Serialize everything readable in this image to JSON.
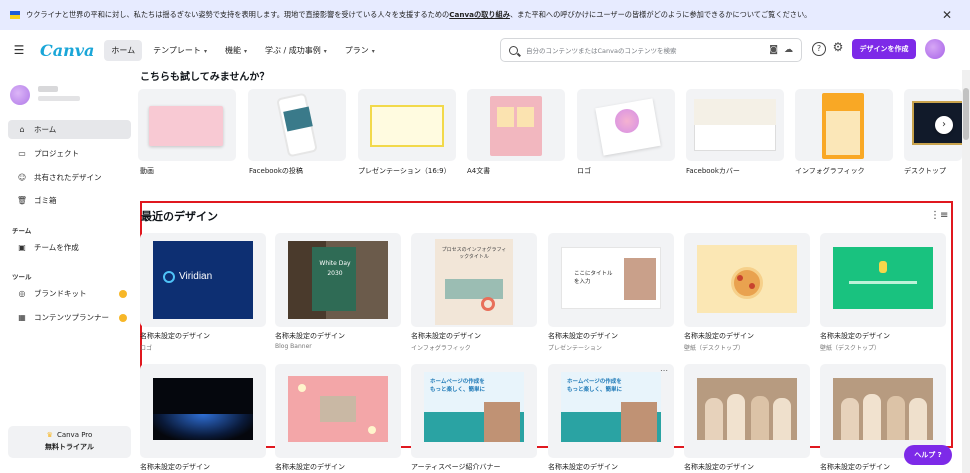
{
  "banner": {
    "text_before": "ウクライナと世界の平和に対し、私たちは揺るぎない姿勢で支持を表明します。現地で直接影響を受けている人々を支援するための",
    "link": "Canvaの取り組み",
    "text_after": "、また平和への呼びかけにユーザーの皆様がどのように参加できるかについてご覧ください。",
    "close": "✕"
  },
  "header": {
    "logo": "Canva",
    "nav": [
      {
        "label": "ホーム",
        "active": true
      },
      {
        "label": "テンプレート",
        "caret": "▾"
      },
      {
        "label": "機能",
        "caret": "▾"
      },
      {
        "label": "学ぶ / 成功事例",
        "caret": "▾"
      },
      {
        "label": "プラン",
        "caret": "▾"
      }
    ],
    "search_placeholder": "自分のコンテンツまたはCanvaのコンテンツを検索",
    "help_icon": "?",
    "settings_icon": "⚙",
    "create_button": "デザインを作成"
  },
  "sidebar": {
    "items": [
      {
        "label": "ホーム",
        "icon": "⌂",
        "active": true
      },
      {
        "label": "プロジェクト",
        "icon": "▭"
      },
      {
        "label": "共有されたデザイン",
        "icon": "☺"
      },
      {
        "label": "ゴミ箱",
        "icon": "🗑"
      }
    ],
    "team_heading": "チーム",
    "team_items": [
      {
        "label": "チームを作成",
        "icon": "▣"
      }
    ],
    "tools_heading": "ツール",
    "tool_items": [
      {
        "label": "ブランドキット",
        "icon": "◎"
      },
      {
        "label": "コンテンツプランナー",
        "icon": "▦"
      }
    ],
    "trial": {
      "line1": "Canva Pro",
      "line2": "無料トライアル",
      "crown": "♛"
    }
  },
  "suggest": {
    "title": "こちらも試してみませんか？",
    "items": [
      {
        "label": "動画"
      },
      {
        "label": "Facebookの投稿"
      },
      {
        "label": "プレゼンテーション（16:9）"
      },
      {
        "label": "A4文書"
      },
      {
        "label": "ロゴ"
      },
      {
        "label": "Facebookカバー"
      },
      {
        "label": "インフォグラフィック"
      },
      {
        "label": "デスクトップ"
      }
    ],
    "next": "›"
  },
  "recent": {
    "title": "最近のデザイン",
    "grid_icon": "⋮≡",
    "row1": [
      {
        "title": "名称未設定のデザイン",
        "sub": "ロゴ",
        "thumb_text": "Viridian"
      },
      {
        "title": "名称未設定のデザイン",
        "sub": "Blog Banner",
        "thumb_text": "White Day\n2030"
      },
      {
        "title": "名称未設定のデザイン",
        "sub": "インフォグラフィック",
        "thumb_text": "プロセスのインフォグラフィックタイトル"
      },
      {
        "title": "名称未設定のデザイン",
        "sub": "プレゼンテーション",
        "thumb_text": "ここにタイトルを入力"
      },
      {
        "title": "名称未設定のデザイン",
        "sub": "壁紙（デスクトップ）",
        "thumb_text": ""
      },
      {
        "title": "名称未設定のデザイン",
        "sub": "壁紙（デスクトップ）",
        "thumb_text": ""
      }
    ],
    "row2": [
      {
        "title": "名称未設定のデザイン"
      },
      {
        "title": "名称未設定のデザイン"
      },
      {
        "title": "アーティスページ紹介バナー",
        "thumb_text": "ホームページの作成をもっと楽しく、簡単に"
      },
      {
        "title": "名称未設定のデザイン",
        "thumb_text": "ホームページの作成をもっと楽しく、簡単に"
      },
      {
        "title": "名称未設定のデザイン"
      },
      {
        "title": "名称未設定のデザイン"
      }
    ]
  },
  "help_button": "ヘルプ ?"
}
